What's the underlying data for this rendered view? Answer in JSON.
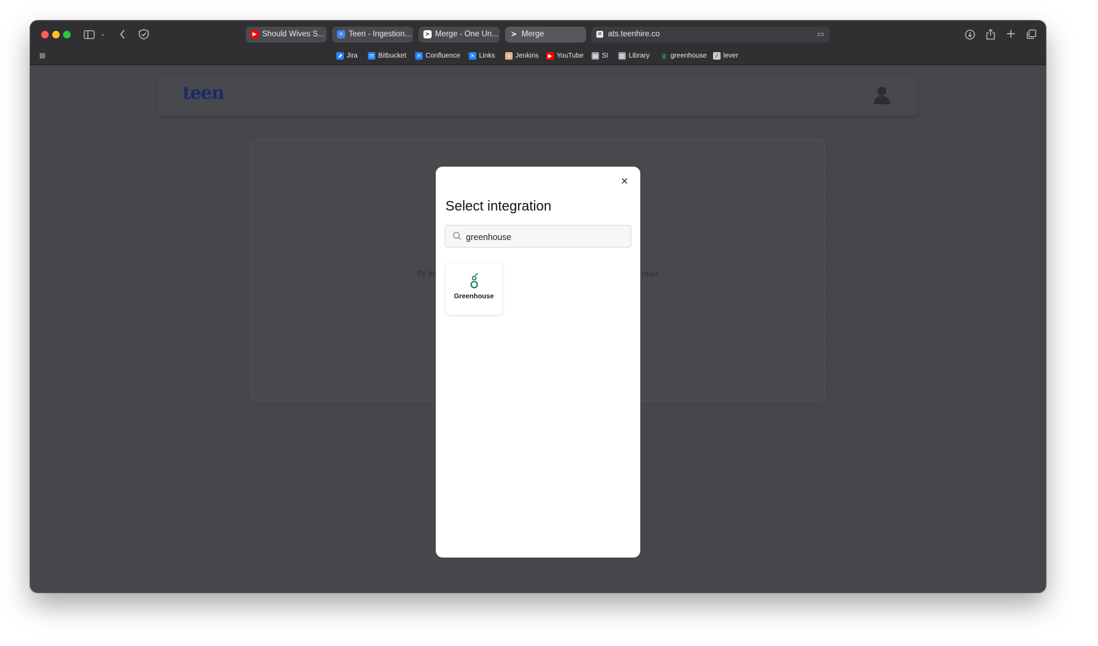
{
  "browser": {
    "tabs": [
      {
        "label": "Should Wives S...",
        "icon": "youtube-icon",
        "color": "#ff0000"
      },
      {
        "label": "Teen - Ingestion...",
        "icon": "google-docs-icon",
        "color": "#4285f4"
      },
      {
        "label": "Merge - One Un...",
        "icon": "merge-icon",
        "color": "#ffffff"
      },
      {
        "label": "Merge",
        "icon": "merge-icon",
        "color": "#ffffff"
      }
    ],
    "address": "ats.teenhire.co",
    "bookmarks": [
      {
        "label": "Jira",
        "icon": "jira-icon",
        "color": "#2684ff"
      },
      {
        "label": "Bitbucket",
        "icon": "bitbucket-icon",
        "color": "#2684ff"
      },
      {
        "label": "Confluence",
        "icon": "confluence-icon",
        "color": "#2684ff"
      },
      {
        "label": "Links",
        "icon": "links-icon",
        "color": "#2684ff"
      },
      {
        "label": "Jenkins",
        "icon": "jenkins-icon",
        "color": "#d8b48a"
      },
      {
        "label": "YouTube",
        "icon": "youtube-icon",
        "color": "#ff0000"
      },
      {
        "label": "SI",
        "icon": "si-icon",
        "color": "#9aa0a6"
      },
      {
        "label": "Library",
        "icon": "library-icon",
        "color": "#9aa0a6"
      },
      {
        "label": "greenhouse",
        "icon": "greenhouse-icon",
        "color": "#24a47f"
      },
      {
        "label": "lever",
        "icon": "lever-icon",
        "color": "#cccccc"
      }
    ]
  },
  "app": {
    "logo": "teen",
    "dropzone_left_fragment": "By lin",
    "dropzone_right_fragment": "read"
  },
  "modal": {
    "title": "Select integration",
    "search_value": "greenhouse",
    "results": [
      {
        "name": "Greenhouse",
        "icon": "greenhouse-logo-icon",
        "color": "#0c7a5c"
      }
    ]
  }
}
